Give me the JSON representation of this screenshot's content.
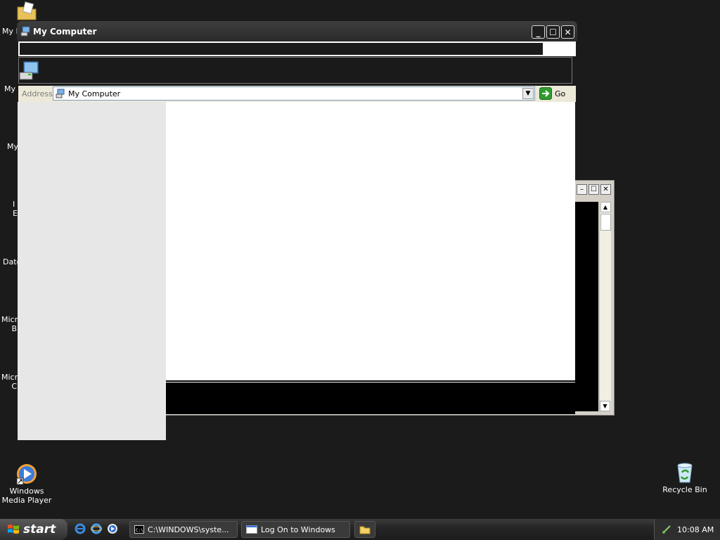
{
  "desktop": {
    "icons": [
      {
        "label": "Windows Media Player",
        "icon": "windows-media-player-icon"
      },
      {
        "label": "Recycle Bin",
        "icon": "recycle-bin-icon"
      }
    ],
    "partial_labels": [
      "My I",
      "My",
      "My",
      "I\nE",
      "Date",
      "Micro\nB",
      "Micro\nC"
    ]
  },
  "explorer": {
    "title": "My Computer",
    "address_label": "Address",
    "address_value": "My Computer",
    "go_label": "Go"
  },
  "taskbar": {
    "start_label": "start",
    "tasks": [
      {
        "label": "C:\\WINDOWS\\syste...",
        "icon": "command-prompt-icon"
      },
      {
        "label": "Log On to Windows",
        "icon": "window-icon"
      },
      {
        "label": "",
        "icon": "folder-icon"
      }
    ],
    "clock": "10:08 AM"
  },
  "colors": {
    "desktop": "#1b1b1b",
    "go_arrow": "#2f9a2f"
  }
}
